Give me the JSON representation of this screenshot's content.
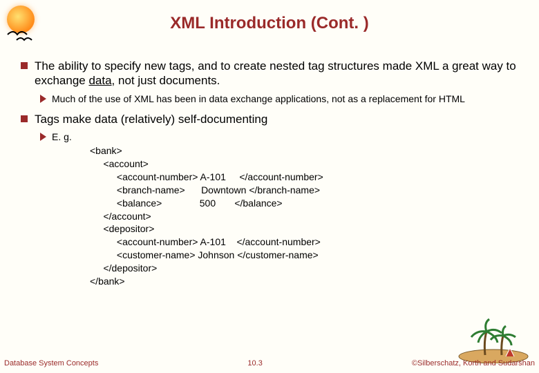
{
  "title": "XML Introduction (Cont. )",
  "bullets": {
    "b1": {
      "prefix": "The ability to specify new tags, and to create nested tag structures made XML a great way to exchange ",
      "underlined": "data",
      "suffix": ", not just documents.",
      "sub": "Much of the use of XML has been in data exchange applications, not as a replacement for HTML"
    },
    "b2": {
      "text": "Tags make data (relatively) self-documenting",
      "sublabel": "E. g."
    }
  },
  "code": {
    "l0": "<bank>",
    "l1": "     <account>",
    "l2": "          <account-number> A-101     </account-number>",
    "l3": "          <branch-name>      Downtown </branch-name>",
    "l4": "          <balance>              500       </balance>",
    "l5": "     </account>",
    "l6": "     <depositor>",
    "l7": "          <account-number> A-101    </account-number>",
    "l8": "          <customer-name> Johnson </customer-name>",
    "l9": "     </depositor>",
    "l10": "</bank>"
  },
  "footer": {
    "left": "Database System Concepts",
    "center": "10.3",
    "right": "©Silberschatz, Korth and Sudarshan"
  }
}
